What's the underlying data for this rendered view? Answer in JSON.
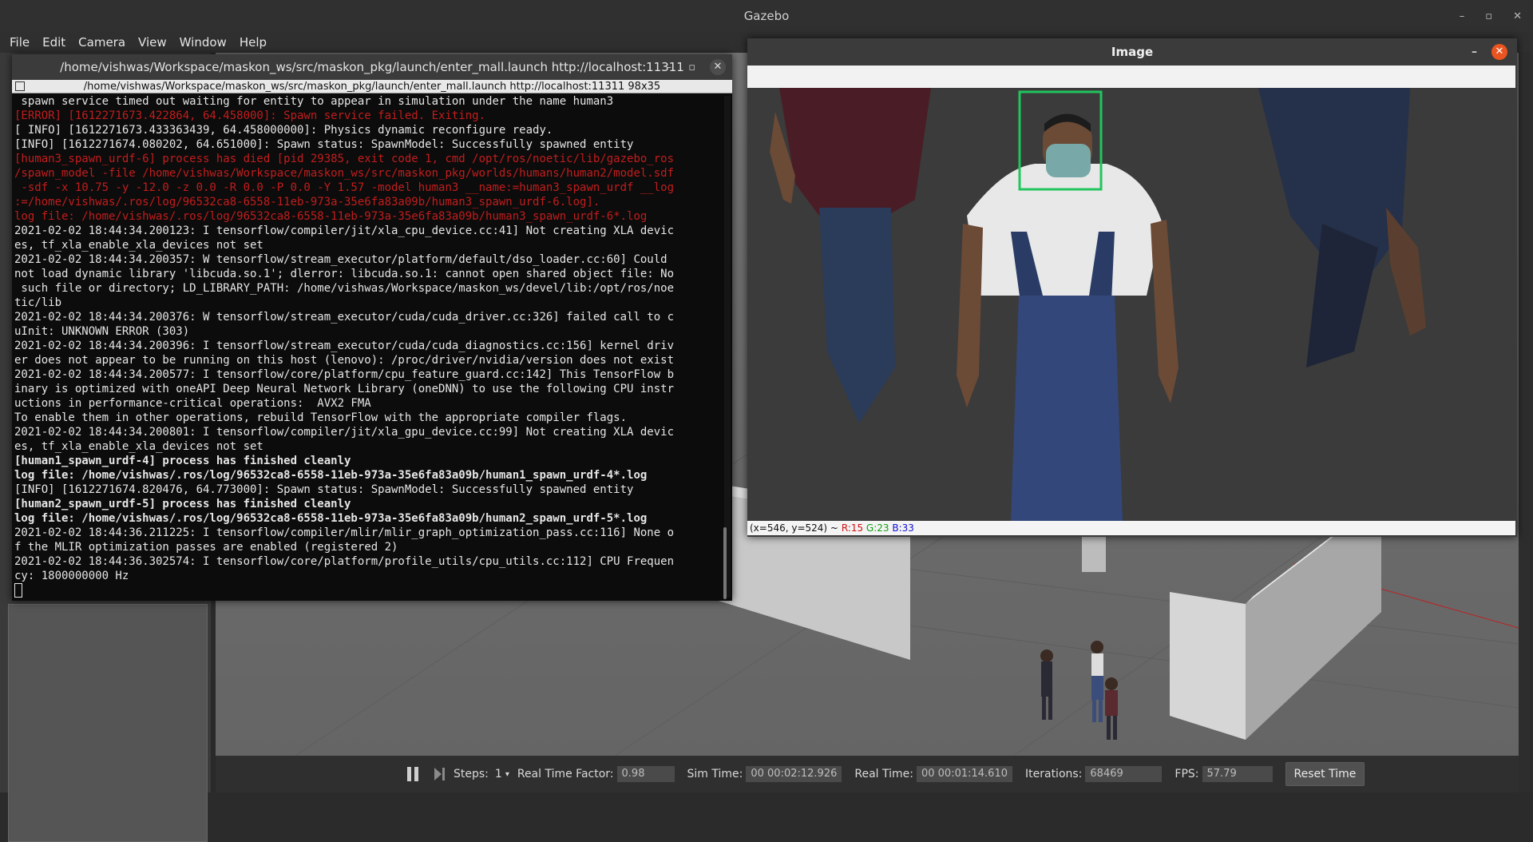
{
  "gazebo": {
    "title": "Gazebo",
    "window_controls": [
      "–",
      "▫",
      "✕"
    ],
    "menu": [
      "File",
      "Edit",
      "Camera",
      "View",
      "Window",
      "Help"
    ],
    "toolbar": {
      "steps_label": "Steps:",
      "steps_value": "1",
      "rtf_label": "Real Time Factor:",
      "rtf_value": "0.98",
      "sim_time_label": "Sim Time:",
      "sim_time_value": "00 00:02:12.926",
      "real_time_label": "Real Time:",
      "real_time_value": "00 00:01:14.610",
      "iterations_label": "Iterations:",
      "iterations_value": "68469",
      "fps_label": "FPS:",
      "fps_value": "57.79",
      "reset_label": "Reset Time"
    }
  },
  "terminal": {
    "title": "/home/vishwas/Workspace/maskon_ws/src/maskon_pkg/launch/enter_mall.launch http://localhost:11311",
    "tab_title": "/home/vishwas/Workspace/maskon_ws/src/maskon_pkg/launch/enter_mall.launch http://localhost:11311 98x35",
    "lines": [
      {
        "t": " spawn service timed out waiting for entity to appear in simulation under the name human3",
        "c": ""
      },
      {
        "t": "[ERROR] [1612271673.422864, 64.458000]: Spawn service failed. Exiting.",
        "c": "err"
      },
      {
        "t": "[ INFO] [1612271673.433363439, 64.458000000]: Physics dynamic reconfigure ready.",
        "c": ""
      },
      {
        "t": "[INFO] [1612271674.080202, 64.651000]: Spawn status: SpawnModel: Successfully spawned entity",
        "c": ""
      },
      {
        "t": "[human3_spawn_urdf-6] process has died [pid 29385, exit code 1, cmd /opt/ros/noetic/lib/gazebo_ros",
        "c": "err"
      },
      {
        "t": "/spawn_model -file /home/vishwas/Workspace/maskon_ws/src/maskon_pkg/worlds/humans/human2/model.sdf",
        "c": "err"
      },
      {
        "t": " -sdf -x 10.75 -y -12.0 -z 0.0 -R 0.0 -P 0.0 -Y 1.57 -model human3 __name:=human3_spawn_urdf __log",
        "c": "err"
      },
      {
        "t": ":=/home/vishwas/.ros/log/96532ca8-6558-11eb-973a-35e6fa83a09b/human3_spawn_urdf-6.log].",
        "c": "err"
      },
      {
        "t": "log file: /home/vishwas/.ros/log/96532ca8-6558-11eb-973a-35e6fa83a09b/human3_spawn_urdf-6*.log",
        "c": "err"
      },
      {
        "t": "2021-02-02 18:44:34.200123: I tensorflow/compiler/jit/xla_cpu_device.cc:41] Not creating XLA devic",
        "c": ""
      },
      {
        "t": "es, tf_xla_enable_xla_devices not set",
        "c": ""
      },
      {
        "t": "2021-02-02 18:44:34.200357: W tensorflow/stream_executor/platform/default/dso_loader.cc:60] Could",
        "c": ""
      },
      {
        "t": "not load dynamic library 'libcuda.so.1'; dlerror: libcuda.so.1: cannot open shared object file: No",
        "c": ""
      },
      {
        "t": " such file or directory; LD_LIBRARY_PATH: /home/vishwas/Workspace/maskon_ws/devel/lib:/opt/ros/noe",
        "c": ""
      },
      {
        "t": "tic/lib",
        "c": ""
      },
      {
        "t": "2021-02-02 18:44:34.200376: W tensorflow/stream_executor/cuda/cuda_driver.cc:326] failed call to c",
        "c": ""
      },
      {
        "t": "uInit: UNKNOWN ERROR (303)",
        "c": ""
      },
      {
        "t": "2021-02-02 18:44:34.200396: I tensorflow/stream_executor/cuda/cuda_diagnostics.cc:156] kernel driv",
        "c": ""
      },
      {
        "t": "er does not appear to be running on this host (lenovo): /proc/driver/nvidia/version does not exist",
        "c": ""
      },
      {
        "t": "2021-02-02 18:44:34.200577: I tensorflow/core/platform/cpu_feature_guard.cc:142] This TensorFlow b",
        "c": ""
      },
      {
        "t": "inary is optimized with oneAPI Deep Neural Network Library (oneDNN) to use the following CPU instr",
        "c": ""
      },
      {
        "t": "uctions in performance-critical operations:  AVX2 FMA",
        "c": ""
      },
      {
        "t": "To enable them in other operations, rebuild TensorFlow with the appropriate compiler flags.",
        "c": ""
      },
      {
        "t": "2021-02-02 18:44:34.200801: I tensorflow/compiler/jit/xla_gpu_device.cc:99] Not creating XLA devic",
        "c": ""
      },
      {
        "t": "es, tf_xla_enable_xla_devices not set",
        "c": ""
      },
      {
        "t": "[human1_spawn_urdf-4] process has finished cleanly",
        "c": "bold"
      },
      {
        "t": "log file: /home/vishwas/.ros/log/96532ca8-6558-11eb-973a-35e6fa83a09b/human1_spawn_urdf-4*.log",
        "c": "bold"
      },
      {
        "t": "[INFO] [1612271674.820476, 64.773000]: Spawn status: SpawnModel: Successfully spawned entity",
        "c": ""
      },
      {
        "t": "[human2_spawn_urdf-5] process has finished cleanly",
        "c": "bold"
      },
      {
        "t": "log file: /home/vishwas/.ros/log/96532ca8-6558-11eb-973a-35e6fa83a09b/human2_spawn_urdf-5*.log",
        "c": "bold"
      },
      {
        "t": "2021-02-02 18:44:36.211225: I tensorflow/compiler/mlir/mlir_graph_optimization_pass.cc:116] None o",
        "c": ""
      },
      {
        "t": "f the MLIR optimization passes are enabled (registered 2)",
        "c": ""
      },
      {
        "t": "2021-02-02 18:44:36.302574: I tensorflow/core/platform/profile_utils/cpu_utils.cc:112] CPU Frequen",
        "c": ""
      },
      {
        "t": "cy: 1800000000 Hz",
        "c": ""
      }
    ]
  },
  "image_window": {
    "title": "Image",
    "status": {
      "coords": "(x=546, y=524) ~",
      "r": "R:15",
      "g": "G:23",
      "b": "B:33"
    }
  },
  "colors": {
    "error_red": "#c21d1d",
    "ubuntu_close": "#e95420",
    "face_box": "#22c55e"
  }
}
